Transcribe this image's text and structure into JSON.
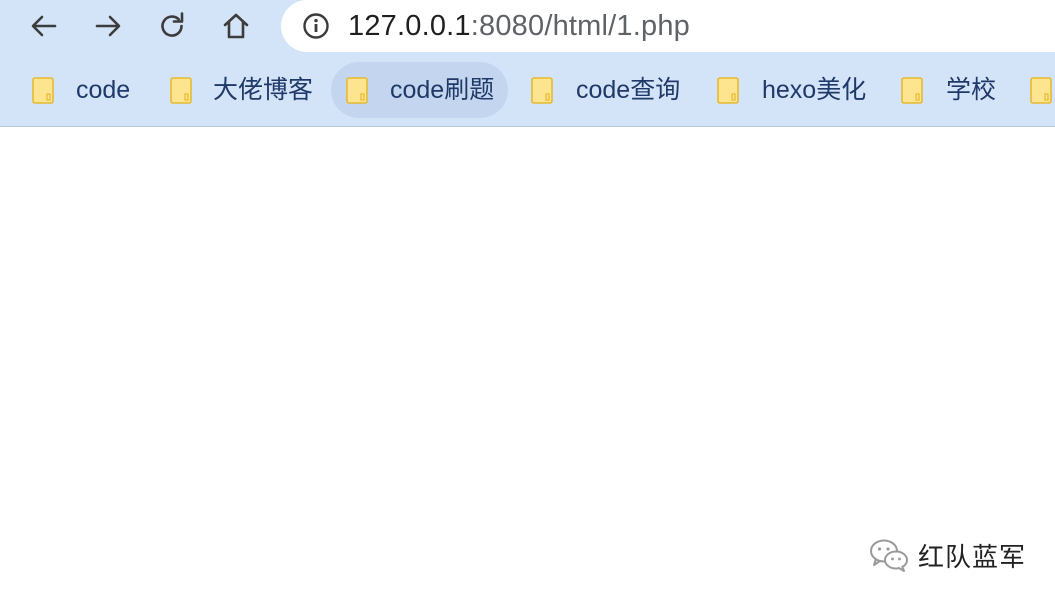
{
  "toolbar": {
    "back_icon": "back-arrow-icon",
    "forward_icon": "forward-arrow-icon",
    "reload_icon": "reload-icon",
    "home_icon": "home-icon"
  },
  "address_bar": {
    "security_icon": "info-icon",
    "host": "127.0.0.1",
    "path": ":8080/html/1.php"
  },
  "bookmarks": {
    "items": [
      {
        "label": "code"
      },
      {
        "label": "大佬博客"
      },
      {
        "label": "code刷题"
      },
      {
        "label": "code查询"
      },
      {
        "label": "hexo美化"
      },
      {
        "label": "学校"
      },
      {
        "label": ""
      }
    ]
  },
  "watermark": {
    "text": "红队蓝军"
  },
  "colors": {
    "chrome_bg": "#d3e3f8",
    "folder_fill": "#fde58f",
    "folder_stroke": "#e6b932",
    "bookmark_text": "#1f3a68"
  }
}
